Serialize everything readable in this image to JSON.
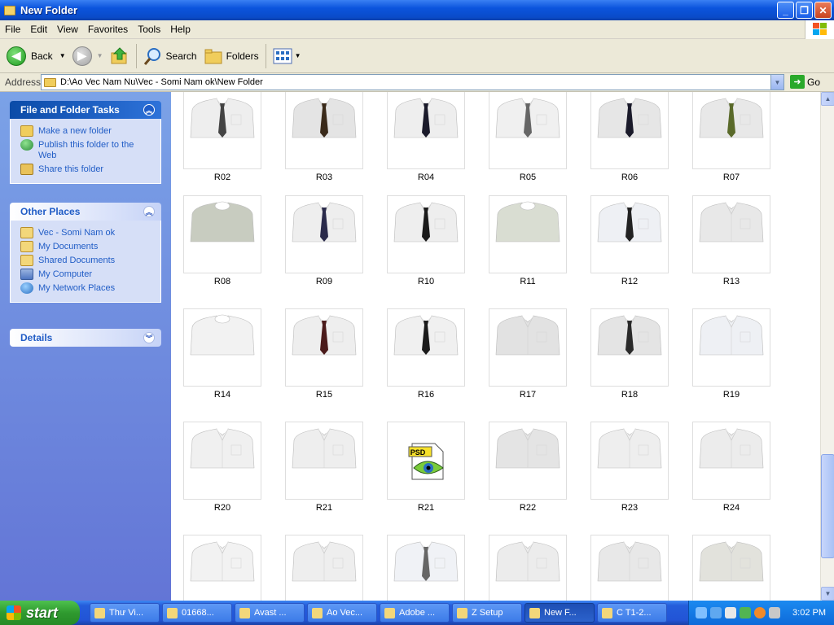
{
  "window": {
    "title": "New Folder",
    "minimize": "_",
    "restore": "❐",
    "close": "✕"
  },
  "menu": [
    {
      "id": "file",
      "label": "File"
    },
    {
      "id": "edit",
      "label": "Edit"
    },
    {
      "id": "view",
      "label": "View"
    },
    {
      "id": "favorites",
      "label": "Favorites"
    },
    {
      "id": "tools",
      "label": "Tools"
    },
    {
      "id": "help",
      "label": "Help"
    }
  ],
  "toolbar": {
    "back": "Back",
    "search": "Search",
    "folders": "Folders"
  },
  "address": {
    "label": "Address",
    "path": "D:\\Ao Vec Nam Nu\\Vec - Somi Nam ok\\New Folder",
    "go": "Go"
  },
  "tasks_panel": {
    "title": "File and Folder Tasks",
    "items": [
      "Make a new folder",
      "Publish this folder to the Web",
      "Share this folder"
    ]
  },
  "places_panel": {
    "title": "Other Places",
    "items": [
      "Vec - Somi Nam ok",
      "My Documents",
      "Shared Documents",
      "My Computer",
      "My Network Places"
    ]
  },
  "details_panel": {
    "title": "Details"
  },
  "psd_badge": "PSD",
  "files": [
    {
      "name": "R02",
      "kind": "shirt",
      "tie": "#444444",
      "shirt": "#eeeeee"
    },
    {
      "name": "R03",
      "kind": "shirt",
      "tie": "#3a2a1a",
      "shirt": "#e4e4e4"
    },
    {
      "name": "R04",
      "kind": "shirt",
      "tie": "#1a1a2a",
      "shirt": "#eeeeee"
    },
    {
      "name": "R05",
      "kind": "shirt",
      "tie": "#666666",
      "shirt": "#f0f0f0"
    },
    {
      "name": "R06",
      "kind": "shirt",
      "tie": "#1a1a2a",
      "shirt": "#e6e6e6"
    },
    {
      "name": "R07",
      "kind": "shirt",
      "tie": "#5a6a2a",
      "shirt": "#e8e8e8"
    },
    {
      "name": "R08",
      "kind": "tee",
      "tie": "",
      "shirt": "#c8ccc0"
    },
    {
      "name": "R09",
      "kind": "shirt",
      "tie": "#2a2a4a",
      "shirt": "#eeeeee"
    },
    {
      "name": "R10",
      "kind": "shirt",
      "tie": "#1a1a1a",
      "shirt": "#eeeeee"
    },
    {
      "name": "R11",
      "kind": "tee",
      "tie": "",
      "shirt": "#d9ddd2"
    },
    {
      "name": "R12",
      "kind": "shirt",
      "tie": "#222222",
      "shirt": "#eef0f4"
    },
    {
      "name": "R13",
      "kind": "shirt",
      "tie": "",
      "shirt": "#e8e8e8"
    },
    {
      "name": "R14",
      "kind": "tee",
      "tie": "",
      "shirt": "#f2f2f2"
    },
    {
      "name": "R15",
      "kind": "shirt",
      "tie": "#4a1a1a",
      "shirt": "#eeeeee"
    },
    {
      "name": "R16",
      "kind": "shirt",
      "tie": "#1a1a1a",
      "shirt": "#f0f0f0"
    },
    {
      "name": "R17",
      "kind": "shirt",
      "tie": "",
      "shirt": "#e2e2e2"
    },
    {
      "name": "R18",
      "kind": "shirt",
      "tie": "#2a2a2a",
      "shirt": "#e4e4e4"
    },
    {
      "name": "R19",
      "kind": "shirt",
      "tie": "",
      "shirt": "#eef0f4"
    },
    {
      "name": "R20",
      "kind": "shirt",
      "tie": "",
      "shirt": "#f0f0f0"
    },
    {
      "name": "R21",
      "kind": "shirt",
      "tie": "",
      "shirt": "#eeeeee"
    },
    {
      "name": "R21",
      "kind": "psd",
      "tie": "",
      "shirt": ""
    },
    {
      "name": "R22",
      "kind": "shirt",
      "tie": "",
      "shirt": "#e4e4e4"
    },
    {
      "name": "R23",
      "kind": "shirt",
      "tie": "",
      "shirt": "#eeeeee"
    },
    {
      "name": "R24",
      "kind": "shirt",
      "tie": "",
      "shirt": "#ececec"
    },
    {
      "name": "",
      "kind": "shirt",
      "tie": "",
      "shirt": "#f2f2f2"
    },
    {
      "name": "",
      "kind": "shirt",
      "tie": "",
      "shirt": "#eeeeee"
    },
    {
      "name": "",
      "kind": "shirt",
      "tie": "#666666",
      "shirt": "#f0f2f6"
    },
    {
      "name": "",
      "kind": "shirt",
      "tie": "",
      "shirt": "#ececec"
    },
    {
      "name": "",
      "kind": "shirt",
      "tie": "",
      "shirt": "#e8e8e8"
    },
    {
      "name": "",
      "kind": "shirt",
      "tie": "",
      "shirt": "#e2e2dc"
    }
  ],
  "taskbar": {
    "start": "start",
    "tasks": [
      {
        "label": "Thư Vi..."
      },
      {
        "label": "01668..."
      },
      {
        "label": "Avast ..."
      },
      {
        "label": "Ao Vec..."
      },
      {
        "label": "Adobe ..."
      },
      {
        "label": "Z Setup"
      },
      {
        "label": "New F...",
        "active": true
      },
      {
        "label": "C T1-2..."
      }
    ],
    "clock": "3:02 PM"
  }
}
